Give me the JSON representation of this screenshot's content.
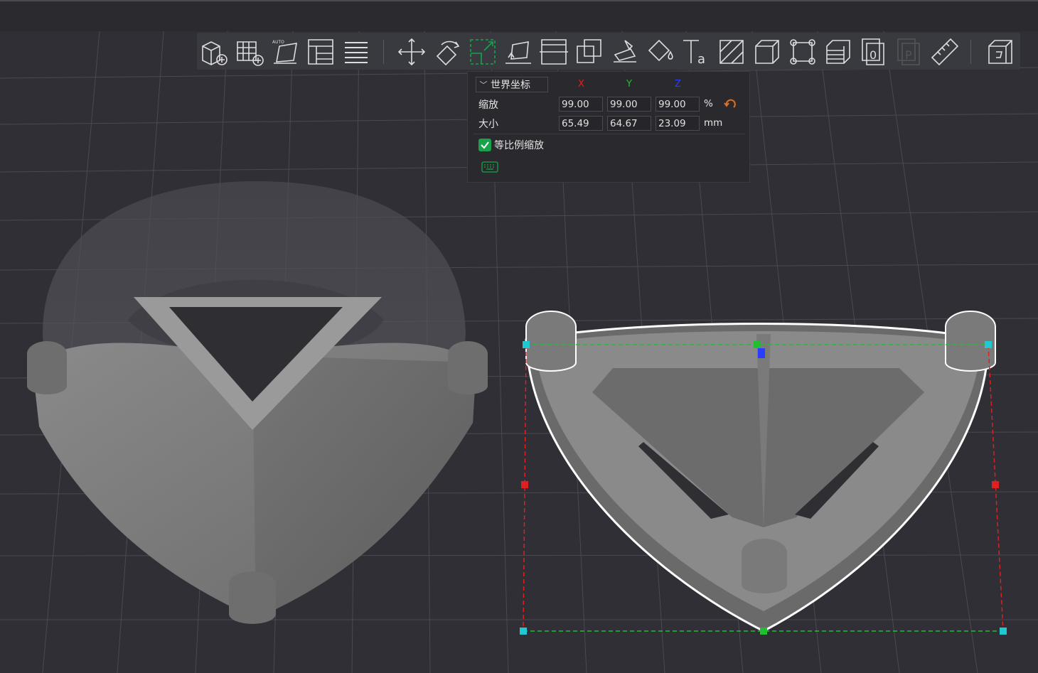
{
  "toolbar": {
    "tools": [
      {
        "name": "add-model-tool",
        "label": "add-model-icon"
      },
      {
        "name": "add-plate-tool",
        "label": "add-plate-icon"
      },
      {
        "name": "auto-arrange-tool",
        "label": "auto-arrange-icon"
      },
      {
        "name": "layout-tool",
        "label": "layout-icon"
      },
      {
        "name": "list-tool",
        "label": "list-icon"
      },
      {
        "name": "move-tool",
        "label": "move-icon"
      },
      {
        "name": "rotate-tool",
        "label": "rotate-icon"
      },
      {
        "name": "scale-tool",
        "label": "scale-icon"
      },
      {
        "name": "lay-on-face-tool",
        "label": "lay-on-face-icon"
      },
      {
        "name": "cut-tool",
        "label": "cut-icon"
      },
      {
        "name": "boolean-tool",
        "label": "boolean-icon"
      },
      {
        "name": "support-paint-tool",
        "label": "support-paint-icon"
      },
      {
        "name": "color-paint-tool",
        "label": "color-paint-icon"
      },
      {
        "name": "text-tool",
        "label": "text-icon"
      },
      {
        "name": "seam-tool",
        "label": "seam-icon"
      },
      {
        "name": "fuzzy-skin-tool",
        "label": "fuzzy-skin-icon"
      },
      {
        "name": "brim-ear-tool",
        "label": "brim-ear-icon"
      },
      {
        "name": "variable-layer-tool",
        "label": "variable-layer-icon"
      },
      {
        "name": "copies-tool",
        "label": "copies-icon"
      },
      {
        "name": "plate-tool",
        "label": "plate-icon"
      },
      {
        "name": "measure-tool",
        "label": "ruler-icon"
      },
      {
        "name": "assembly-tool",
        "label": "assembly-icon"
      }
    ]
  },
  "scale_panel": {
    "coordinate_system": "世界坐标",
    "axis_x": "X",
    "axis_y": "Y",
    "axis_z": "Z",
    "scale_label": "缩放",
    "scale_x": "99.00",
    "scale_y": "99.00",
    "scale_z": "99.00",
    "scale_unit": "%",
    "size_label": "大小",
    "size_x": "65.49",
    "size_y": "64.67",
    "size_z": "23.09",
    "size_unit": "mm",
    "uniform_scale_label": "等比例缩放",
    "uniform_scale_checked": true
  },
  "colors": {
    "background": "#2f2f35",
    "axis_x": "#e02020",
    "axis_y": "#1fbf2f",
    "axis_z": "#2a3cff",
    "reset_icon": "#e07020",
    "checkbox": "#17a34a"
  }
}
